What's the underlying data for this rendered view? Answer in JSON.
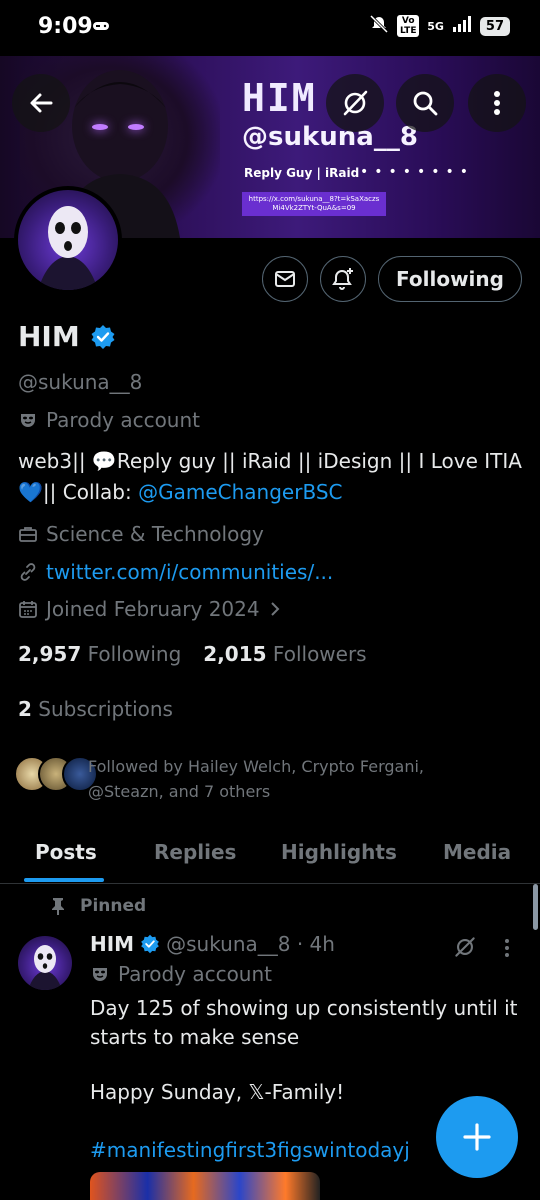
{
  "status_bar": {
    "time": "9:09",
    "network": "5G",
    "volte": "Vo LTE",
    "battery": "57"
  },
  "banner": {
    "title": "HIM",
    "handle": "@sukuna__8",
    "subtitle": "Reply Guy | iRaid",
    "link": "https://x.com/sukuna__8?t=kSaXaczsMi4Vk2ZTYt-QuA&s=09"
  },
  "profile": {
    "name": "HIM",
    "handle": "@sukuna__8",
    "label": "Parody account",
    "bio_line1": "web3|| 💬Reply guy || iRaid || iDesign || I Love ITIA",
    "bio_line2_prefix": "💙|| Collab: ",
    "bio_mention": "@GameChangerBSC",
    "category": "Science & Technology",
    "link": "twitter.com/i/communities/...",
    "joined": "Joined February 2024",
    "following_count": "2,957",
    "following_label": "Following",
    "followers_count": "2,015",
    "followers_label": "Followers",
    "subscriptions_count": "2",
    "subscriptions_label": "Subscriptions",
    "followed_by_line1": "Followed by Hailey Welch, Crypto Fergani,",
    "followed_by_line2": "@Steazn, and 7 others"
  },
  "actions": {
    "following_button": "Following"
  },
  "tabs": [
    {
      "label": "Posts",
      "active": true
    },
    {
      "label": "Replies",
      "active": false
    },
    {
      "label": "Highlights",
      "active": false
    },
    {
      "label": "Media",
      "active": false
    }
  ],
  "post": {
    "pinned_label": "Pinned",
    "name": "HIM",
    "meta": "@sukuna__8 · 4h",
    "label": "Parody account",
    "text_line1": "Day 125 of showing up consistently until it",
    "text_line2": "starts to make sense",
    "text_line3": "Happy Sunday,  𝕏-Family!",
    "hashtag": "#manifestingfirst3figswintodayj"
  },
  "colors": {
    "accent": "#1d9bf0",
    "background": "#000000",
    "muted": "#71767b",
    "text": "#e7e9ea"
  },
  "icons": [
    "back-arrow-icon",
    "grok-icon",
    "search-icon",
    "more-icon",
    "message-icon",
    "notification-plus-icon",
    "verified-badge-icon",
    "mask-icon",
    "briefcase-icon",
    "link-icon",
    "calendar-icon",
    "chevron-right-icon",
    "pin-icon",
    "compose-plus-icon"
  ]
}
